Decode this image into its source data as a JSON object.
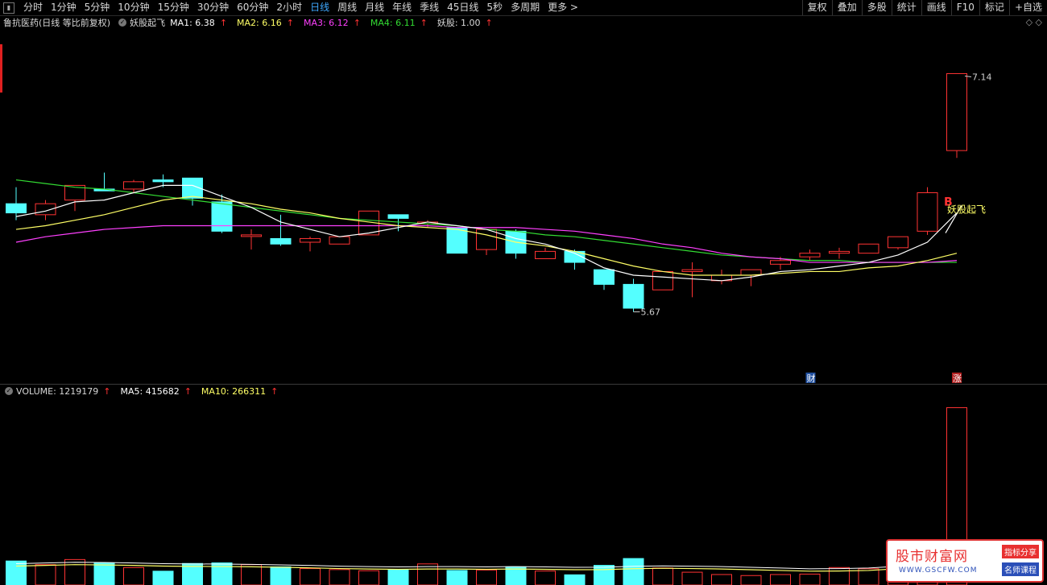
{
  "toolbar": {
    "tabs": [
      "分时",
      "1分钟",
      "5分钟",
      "10分钟",
      "15分钟",
      "30分钟",
      "60分钟",
      "2小时",
      "日线",
      "周线",
      "月线",
      "年线",
      "季线",
      "45日线",
      "5秒",
      "多周期",
      "更多 >"
    ],
    "active_index": 8,
    "right_buttons": [
      "复权",
      "叠加",
      "多股",
      "统计",
      "画线",
      "F10",
      "标记",
      "+自选"
    ]
  },
  "main_legend": {
    "title": "鲁抗医药(日线 等比前复权)",
    "indicator_name": "妖股起飞",
    "ma1": "MA1: 6.38",
    "ma2": "MA2: 6.16",
    "ma3": "MA3: 6.12",
    "ma4": "MA4: 6.11",
    "yao": "妖股: 1.00",
    "arrow": "↑"
  },
  "volume_legend": {
    "volume": "VOLUME: 1219179",
    "ma5": "MA5: 415682",
    "ma10": "MA10: 266311",
    "arrow": "↑"
  },
  "annotations": {
    "high_label": "7.14",
    "low_label": "5.67",
    "signal_b": "B",
    "signal_text": "妖股起飞",
    "cai_badge": "财",
    "zhang_badge": "涨"
  },
  "right_icons": "◇ ◇",
  "watermark": {
    "title": "股市财富网",
    "url": "WWW.GSCFW.COM",
    "tag1": "指标分享",
    "tag2": "名师课程"
  },
  "colors": {
    "up": "#ff3333",
    "down": "#54ffff",
    "ma1": "#ffffff",
    "ma2": "#ffff66",
    "ma3": "#ff40ff",
    "ma4": "#33dd33",
    "active_tab": "#3fa9ff"
  },
  "chart_data": {
    "type": "candlestick",
    "price_range": [
      5.5,
      7.3
    ],
    "candles": [
      {
        "o": 6.43,
        "h": 6.52,
        "l": 6.34,
        "c": 6.38
      },
      {
        "o": 6.37,
        "h": 6.45,
        "l": 6.34,
        "c": 6.43
      },
      {
        "o": 6.45,
        "h": 6.53,
        "l": 6.39,
        "c": 6.53
      },
      {
        "o": 6.51,
        "h": 6.6,
        "l": 6.5,
        "c": 6.5
      },
      {
        "o": 6.51,
        "h": 6.56,
        "l": 6.49,
        "c": 6.55
      },
      {
        "o": 6.56,
        "h": 6.59,
        "l": 6.52,
        "c": 6.55
      },
      {
        "o": 6.57,
        "h": 6.57,
        "l": 6.42,
        "c": 6.46
      },
      {
        "o": 6.44,
        "h": 6.48,
        "l": 6.27,
        "c": 6.28
      },
      {
        "o": 6.26,
        "h": 6.29,
        "l": 6.18,
        "c": 6.26
      },
      {
        "o": 6.24,
        "h": 6.37,
        "l": 6.2,
        "c": 6.21
      },
      {
        "o": 6.22,
        "h": 6.25,
        "l": 6.17,
        "c": 6.24
      },
      {
        "o": 6.21,
        "h": 6.25,
        "l": 6.21,
        "c": 6.25
      },
      {
        "o": 6.26,
        "h": 6.39,
        "l": 6.26,
        "c": 6.39
      },
      {
        "o": 6.37,
        "h": 6.37,
        "l": 6.28,
        "c": 6.35
      },
      {
        "o": 6.32,
        "h": 6.34,
        "l": 6.3,
        "c": 6.33
      },
      {
        "o": 6.3,
        "h": 6.3,
        "l": 6.16,
        "c": 6.16
      },
      {
        "o": 6.18,
        "h": 6.29,
        "l": 6.15,
        "c": 6.29
      },
      {
        "o": 6.28,
        "h": 6.29,
        "l": 6.13,
        "c": 6.16
      },
      {
        "o": 6.13,
        "h": 6.19,
        "l": 6.13,
        "c": 6.17
      },
      {
        "o": 6.17,
        "h": 6.18,
        "l": 6.07,
        "c": 6.11
      },
      {
        "o": 6.07,
        "h": 6.07,
        "l": 5.96,
        "c": 5.99
      },
      {
        "o": 5.99,
        "h": 6.02,
        "l": 5.84,
        "c": 5.86
      },
      {
        "o": 5.96,
        "h": 6.06,
        "l": 5.96,
        "c": 6.06
      },
      {
        "o": 6.06,
        "h": 6.11,
        "l": 5.92,
        "c": 6.07
      },
      {
        "o": 6.01,
        "h": 6.07,
        "l": 5.99,
        "c": 6.04
      },
      {
        "o": 6.04,
        "h": 6.06,
        "l": 5.98,
        "c": 6.07
      },
      {
        "o": 6.1,
        "h": 6.14,
        "l": 6.07,
        "c": 6.12
      },
      {
        "o": 6.14,
        "h": 6.18,
        "l": 6.12,
        "c": 6.16
      },
      {
        "o": 6.16,
        "h": 6.19,
        "l": 6.13,
        "c": 6.17
      },
      {
        "o": 6.16,
        "h": 6.19,
        "l": 6.16,
        "c": 6.21
      },
      {
        "o": 6.19,
        "h": 6.24,
        "l": 6.18,
        "c": 6.25
      },
      {
        "o": 6.28,
        "h": 6.52,
        "l": 6.26,
        "c": 6.49
      },
      {
        "o": 6.72,
        "h": 7.14,
        "l": 6.68,
        "c": 7.14
      }
    ],
    "ma1": [
      6.36,
      6.39,
      6.44,
      6.45,
      6.49,
      6.53,
      6.53,
      6.47,
      6.41,
      6.33,
      6.29,
      6.25,
      6.27,
      6.3,
      6.33,
      6.31,
      6.29,
      6.24,
      6.21,
      6.16,
      6.08,
      6.04,
      6.03,
      6.02,
      6.01,
      6.03,
      6.06,
      6.07,
      6.09,
      6.11,
      6.15,
      6.22,
      6.38
    ],
    "ma2": [
      6.29,
      6.31,
      6.34,
      6.37,
      6.41,
      6.45,
      6.47,
      6.45,
      6.43,
      6.4,
      6.38,
      6.35,
      6.33,
      6.31,
      6.3,
      6.29,
      6.26,
      6.22,
      6.2,
      6.17,
      6.13,
      6.09,
      6.06,
      6.04,
      6.04,
      6.04,
      6.05,
      6.06,
      6.06,
      6.08,
      6.09,
      6.12,
      6.16
    ],
    "ma3": [
      6.22,
      6.25,
      6.27,
      6.29,
      6.3,
      6.31,
      6.31,
      6.31,
      6.31,
      6.31,
      6.31,
      6.31,
      6.31,
      6.31,
      6.31,
      6.3,
      6.3,
      6.3,
      6.29,
      6.28,
      6.26,
      6.24,
      6.21,
      6.19,
      6.16,
      6.14,
      6.13,
      6.11,
      6.11,
      6.11,
      6.11,
      6.11,
      6.12
    ],
    "ma4": [
      6.56,
      6.54,
      6.52,
      6.51,
      6.49,
      6.47,
      6.45,
      6.43,
      6.41,
      6.39,
      6.37,
      6.35,
      6.34,
      6.33,
      6.32,
      6.31,
      6.29,
      6.28,
      6.26,
      6.25,
      6.23,
      6.21,
      6.19,
      6.17,
      6.15,
      6.14,
      6.13,
      6.12,
      6.12,
      6.11,
      6.11,
      6.11,
      6.11
    ],
    "volume_range": [
      0,
      1300000
    ],
    "volumes": [
      165000,
      140000,
      175000,
      150000,
      120000,
      95000,
      148000,
      152000,
      140000,
      125000,
      113000,
      106000,
      98000,
      105000,
      145000,
      100000,
      103000,
      125000,
      96000,
      70000,
      135000,
      182000,
      117000,
      88000,
      72000,
      65000,
      72000,
      75000,
      120000,
      112000,
      150000,
      310000,
      1219179
    ],
    "vol_ma": [
      130000,
      135000,
      140000,
      138000,
      135000,
      130000,
      128000,
      127000,
      125000,
      122000,
      118000,
      113000,
      110000,
      108000,
      110000,
      110000,
      108000,
      110000,
      108000,
      105000,
      106000,
      112000,
      115000,
      113000,
      110000,
      105000,
      100000,
      95000,
      96000,
      100000,
      112000,
      150000,
      266311
    ]
  }
}
